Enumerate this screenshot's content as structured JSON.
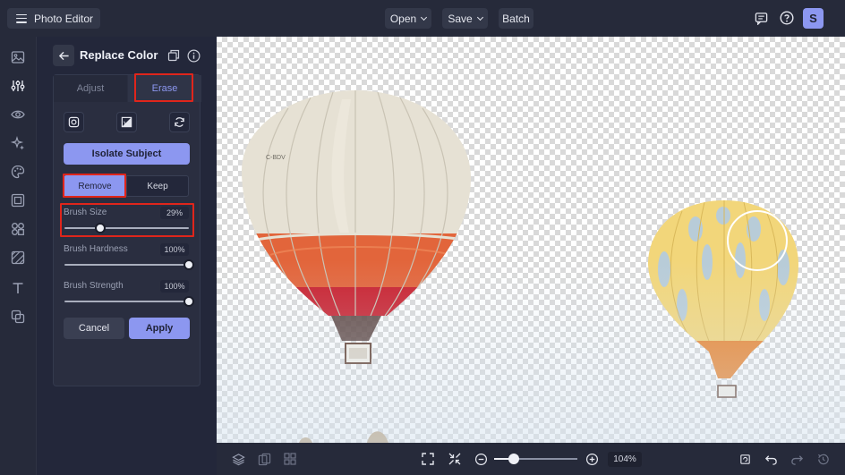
{
  "app": {
    "title": "Photo Editor",
    "menu_icon": "hamburger-icon"
  },
  "top_menu": {
    "open_label": "Open",
    "save_label": "Save",
    "batch_label": "Batch",
    "avatar_initial": "S"
  },
  "rail": {
    "icons": [
      "image-icon",
      "sliders-icon",
      "eye-icon",
      "sparkle-icon",
      "palette-icon",
      "frame-icon",
      "shapes-icon",
      "texture-icon",
      "text-icon",
      "graphics-icon"
    ]
  },
  "panel": {
    "title": "Replace Color",
    "tabs": [
      {
        "label": "Adjust",
        "active": false
      },
      {
        "label": "Erase",
        "active": true
      }
    ],
    "isolate_label": "Isolate Subject",
    "mode": {
      "remove_label": "Remove",
      "keep_label": "Keep",
      "selected": "Remove"
    },
    "sliders": [
      {
        "label": "Brush Size",
        "display": "29%",
        "value": 29
      },
      {
        "label": "Brush Hardness",
        "display": "100%",
        "value": 100
      },
      {
        "label": "Brush Strength",
        "display": "100%",
        "value": 100
      }
    ],
    "cancel_label": "Cancel",
    "apply_label": "Apply"
  },
  "canvas": {
    "balloon_left_marking": "C-BDV"
  },
  "bottom": {
    "zoom_display": "104%",
    "zoom_value": 104
  },
  "colors": {
    "accent": "#8c97f0",
    "highlight_outline": "#e0251b",
    "background": "#1f2230"
  }
}
